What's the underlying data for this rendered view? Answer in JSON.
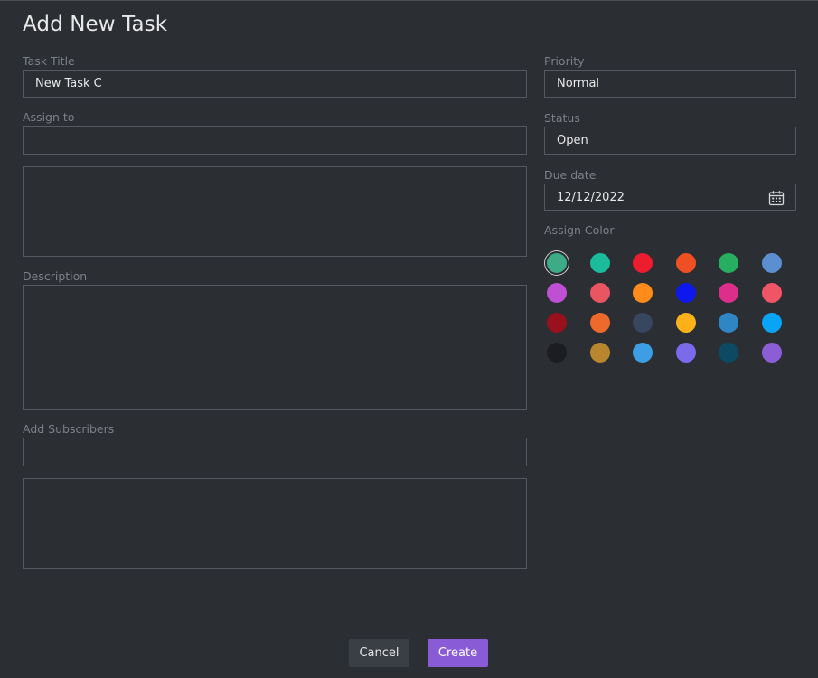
{
  "dialog": {
    "title": "Add New Task"
  },
  "left": {
    "task_title_label": "Task Title",
    "task_title_value": "New Task C",
    "assign_to_label": "Assign to",
    "assign_to_value": "",
    "description_label": "Description",
    "subscribers_label": "Add Subscribers",
    "subscribers_value": ""
  },
  "right": {
    "priority_label": "Priority",
    "priority_value": "Normal",
    "status_label": "Status",
    "status_value": "Open",
    "due_date_label": "Due date",
    "due_date_value": "12/12/2022",
    "assign_color_label": "Assign Color",
    "selected_color": "#3dab85",
    "colors": [
      "#3dab85",
      "#1abc9c",
      "#ed1c2e",
      "#f04e23",
      "#27ae60",
      "#5b8fd0",
      "#bf4fd3",
      "#e95561",
      "#ff8c1a",
      "#0d17ee",
      "#dd2e8b",
      "#ef5565",
      "#98111c",
      "#ee6a2c",
      "#36475f",
      "#fbb117",
      "#2f86c4",
      "#0aa4f6",
      "#1c1d20",
      "#b8862c",
      "#3d9ee5",
      "#7b6bea",
      "#0b4a62",
      "#8c5ed6"
    ]
  },
  "footer": {
    "cancel_label": "Cancel",
    "create_label": "Create"
  }
}
